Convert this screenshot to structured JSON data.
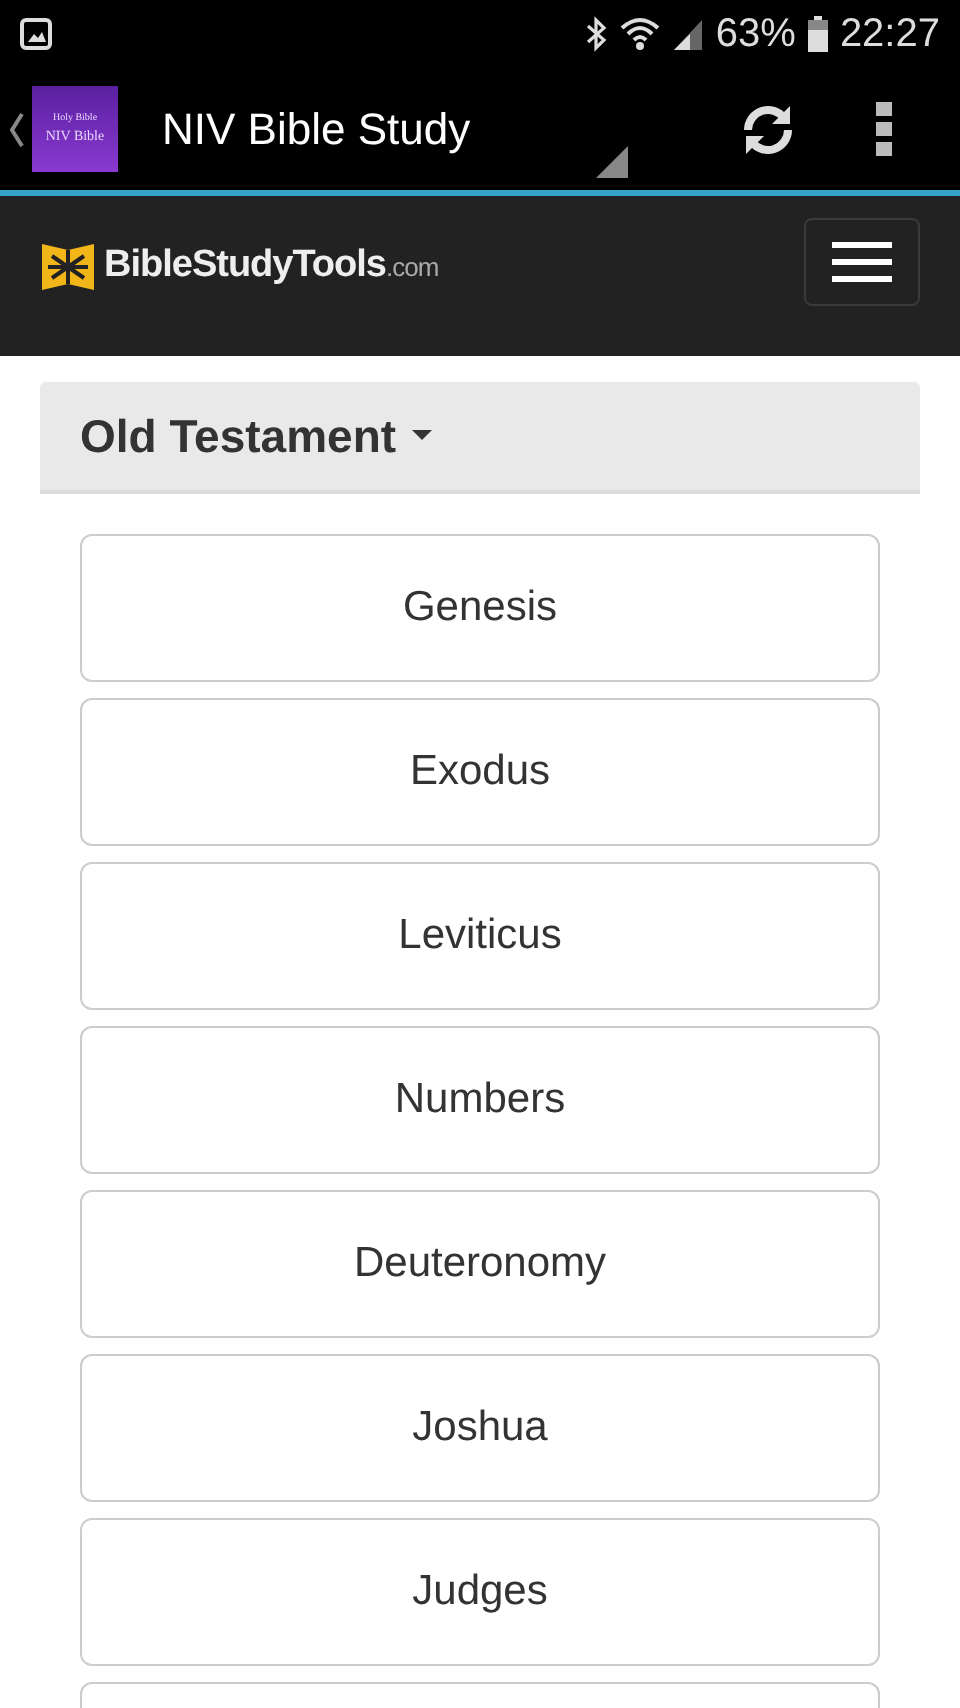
{
  "status_bar": {
    "battery": "63%",
    "time": "22:27"
  },
  "app_bar": {
    "icon_lines": [
      "Holy Bible",
      "NIV Bible"
    ],
    "title": "NIV Bible Study"
  },
  "site_header": {
    "logo_name": "BibleStudyTools",
    "logo_suffix": ".com"
  },
  "section": {
    "title": "Old Testament",
    "expanded": true
  },
  "books": [
    {
      "name": "Genesis"
    },
    {
      "name": "Exodus"
    },
    {
      "name": "Leviticus"
    },
    {
      "name": "Numbers"
    },
    {
      "name": "Deuteronomy"
    },
    {
      "name": "Joshua"
    },
    {
      "name": "Judges"
    }
  ],
  "books_continue_below": true
}
